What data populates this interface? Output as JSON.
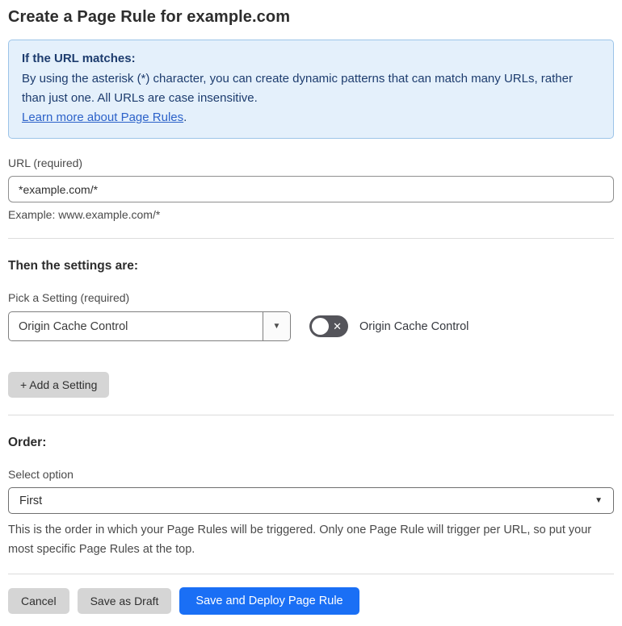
{
  "page": {
    "title": "Create a Page Rule for example.com"
  },
  "info_box": {
    "heading": "If the URL matches:",
    "body": "By using the asterisk (*) character, you can create dynamic patterns that can match many URLs, rather than just one. All URLs are case insensitive.",
    "link_label": "Learn more about Page Rules",
    "link_suffix": "."
  },
  "url_section": {
    "label": "URL (required)",
    "value": "*example.com/*",
    "helper": "Example: www.example.com/*"
  },
  "settings_section": {
    "heading": "Then the settings are:",
    "picker_label": "Pick a Setting (required)",
    "selected_setting": "Origin Cache Control",
    "toggle": {
      "label": "Origin Cache Control",
      "state": "off"
    },
    "add_button_label": "+ Add a Setting"
  },
  "order_section": {
    "heading": "Order:",
    "label": "Select option",
    "selected_option": "First",
    "helper": "This is the order in which your Page Rules will be triggered. Only one Page Rule will trigger per URL, so put your most specific Page Rules at the top."
  },
  "footer": {
    "cancel_label": "Cancel",
    "save_draft_label": "Save as Draft",
    "save_deploy_label": "Save and Deploy Page Rule"
  },
  "icons": {
    "dropdown_arrow": "▼",
    "toggle_x": "✕"
  },
  "colors": {
    "accent_blue": "#1a6ff5",
    "info_box_bg": "#e4f0fb",
    "info_box_border": "#9cc4e8",
    "info_box_text": "#1d3c6e",
    "link_blue": "#2c62c9",
    "toggle_off_bg": "#54545a",
    "gray_button_bg": "#d5d5d5"
  }
}
